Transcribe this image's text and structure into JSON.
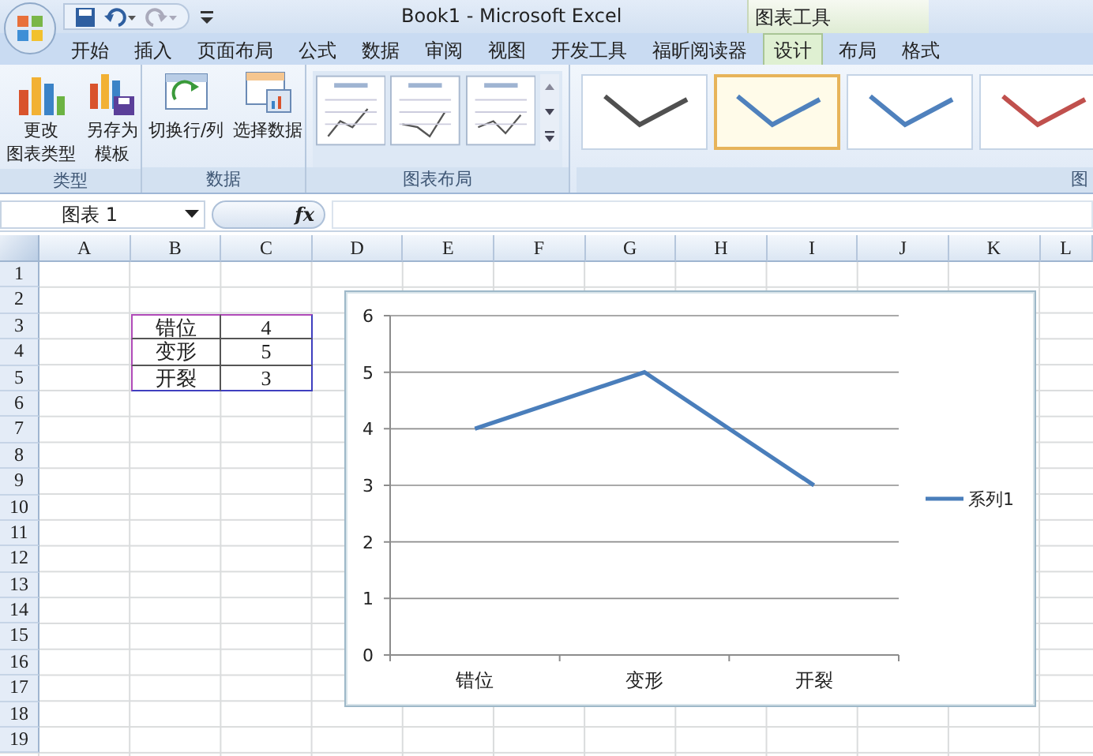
{
  "window": {
    "title": "Book1 - Microsoft Excel",
    "contextual_group": "图表工具"
  },
  "tabs": [
    {
      "label": "开始",
      "selected": false
    },
    {
      "label": "插入",
      "selected": false
    },
    {
      "label": "页面布局",
      "selected": false
    },
    {
      "label": "公式",
      "selected": false
    },
    {
      "label": "数据",
      "selected": false
    },
    {
      "label": "审阅",
      "selected": false
    },
    {
      "label": "视图",
      "selected": false
    },
    {
      "label": "开发工具",
      "selected": false
    },
    {
      "label": "福昕阅读器",
      "selected": false
    },
    {
      "label": "设计",
      "selected": true
    },
    {
      "label": "布局",
      "selected": false
    },
    {
      "label": "格式",
      "selected": false
    }
  ],
  "ribbon": {
    "groups": [
      {
        "label": "类型",
        "kind": "buttons",
        "buttons": [
          {
            "lines": [
              "更改",
              "图表类型"
            ]
          },
          {
            "lines": [
              "另存为",
              "模板"
            ]
          }
        ]
      },
      {
        "label": "数据",
        "kind": "buttons",
        "buttons": [
          {
            "lines": [
              "切换行/列"
            ]
          },
          {
            "lines": [
              "选择数据"
            ]
          }
        ]
      },
      {
        "label": "图表布局",
        "kind": "layouts",
        "layouts": [
          {
            "selected": false
          },
          {
            "selected": false
          },
          {
            "selected": false
          }
        ]
      },
      {
        "label": "图",
        "kind": "styles",
        "styles": [
          {
            "color": "#505050",
            "selected": false
          },
          {
            "color": "#4f81bd",
            "selected": true
          },
          {
            "color": "#4f81bd",
            "selected": false
          },
          {
            "color": "#c0504d",
            "selected": false
          }
        ]
      }
    ]
  },
  "formula_bar": {
    "name_box": "图表 1",
    "fx": "fx"
  },
  "sheet": {
    "columns": [
      "A",
      "B",
      "C",
      "D",
      "E",
      "F",
      "G",
      "H",
      "I",
      "J",
      "K",
      "L"
    ],
    "rows": [
      "1",
      "2",
      "3",
      "4",
      "5",
      "6",
      "7",
      "8",
      "9",
      "10",
      "11",
      "12",
      "13",
      "14",
      "15",
      "16",
      "17",
      "18",
      "19"
    ],
    "data": [
      {
        "label": "错位",
        "value": "4"
      },
      {
        "label": "变形",
        "value": "5"
      },
      {
        "label": "开裂",
        "value": "3"
      }
    ]
  },
  "chart": {
    "chart_data": {
      "type": "line",
      "grid": true,
      "categories": [
        "错位",
        "变形",
        "开裂"
      ],
      "series": [
        {
          "name": "系列1",
          "color": "#4a7ebb",
          "values": [
            4,
            5,
            3
          ]
        }
      ],
      "ylim": [
        0,
        6
      ],
      "yticks": [
        0,
        1,
        2,
        3,
        4,
        5,
        6
      ]
    }
  }
}
